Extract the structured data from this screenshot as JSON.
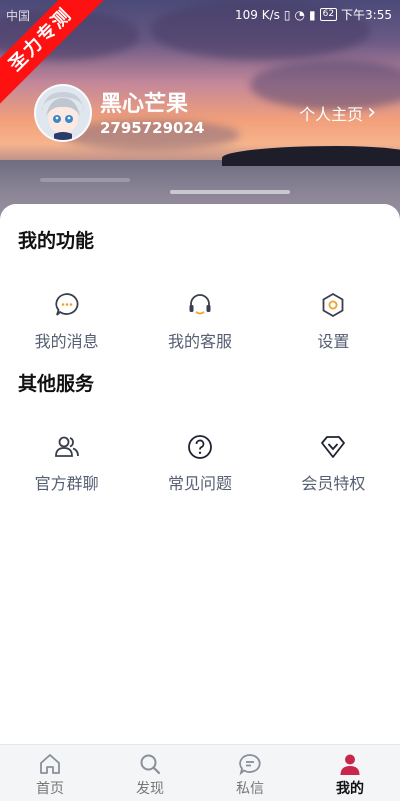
{
  "status_bar": {
    "carrier": "中国",
    "speed": "109 K/s",
    "battery": "62",
    "time": "下午3:55"
  },
  "ribbon": "圣力专测",
  "profile": {
    "name": "黑心芒果",
    "id": "2795729024",
    "homepage_link": "个人主页",
    "homepage_chevron": "›"
  },
  "sections": [
    {
      "title": "我的功能",
      "items": [
        {
          "label": "我的消息",
          "icon": "chat-bubble-icon"
        },
        {
          "label": "我的客服",
          "icon": "headset-icon"
        },
        {
          "label": "设置",
          "icon": "hexagon-gear-icon"
        }
      ]
    },
    {
      "title": "其他服务",
      "items": [
        {
          "label": "官方群聊",
          "icon": "group-users-icon"
        },
        {
          "label": "常见问题",
          "icon": "question-circle-icon"
        },
        {
          "label": "会员特权",
          "icon": "diamond-icon"
        }
      ]
    }
  ],
  "nav": {
    "items": [
      {
        "label": "首页",
        "icon": "home-icon"
      },
      {
        "label": "发现",
        "icon": "search-icon"
      },
      {
        "label": "私信",
        "icon": "message-icon"
      },
      {
        "label": "我的",
        "icon": "profile-icon"
      }
    ],
    "active": "我的",
    "active_color": "#c8264a"
  }
}
